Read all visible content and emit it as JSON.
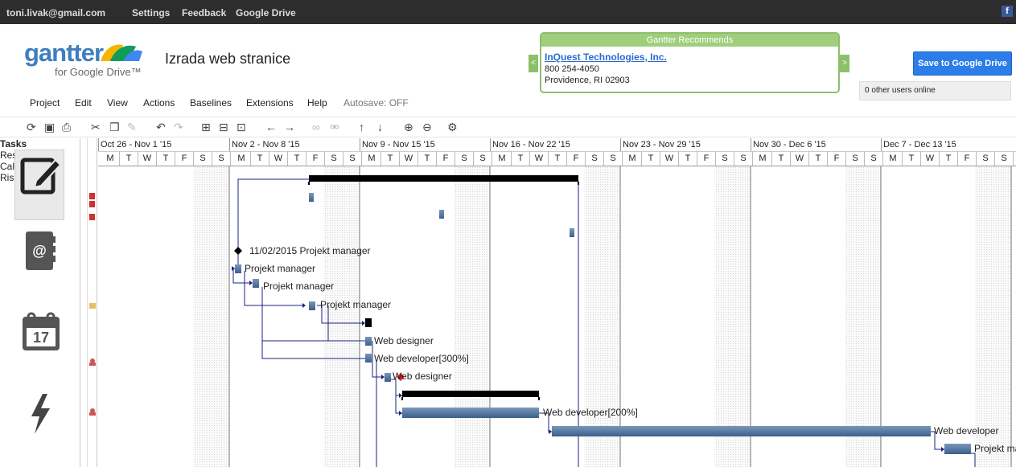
{
  "topbar": {
    "email": "toni.livak@gmail.com",
    "settings": "Settings",
    "feedback": "Feedback",
    "drive": "Google Drive",
    "facebook": "f"
  },
  "logo": {
    "brand": "gantter",
    "sub": "for Google Drive™"
  },
  "project_title": "Izrada web stranice",
  "recommend": {
    "header": "Gantter Recommends",
    "name": "InQuest Technologies, Inc.",
    "phone": "800 254-4050",
    "city": "Providence, RI 02903",
    "prev": "<",
    "next": ">"
  },
  "save_button": "Save to Google Drive",
  "users_online": "0 other users online",
  "menu": {
    "project": "Project",
    "edit": "Edit",
    "view": "View",
    "actions": "Actions",
    "baselines": "Baselines",
    "extensions": "Extensions",
    "help": "Help",
    "autosave": "Autosave: OFF"
  },
  "toolbar_icons": [
    "refresh-icon",
    "save-icon",
    "print-icon",
    "cut-icon",
    "copy-icon",
    "paste-icon",
    "undo-icon",
    "redo-icon",
    "indent-icon",
    "outdent-icon",
    "insert-icon",
    "move-left-icon",
    "move-right-icon",
    "link-icon",
    "unlink-icon",
    "move-up-icon",
    "move-down-icon",
    "zoom-in-icon",
    "zoom-out-icon",
    "settings-icon"
  ],
  "sidebar": {
    "tasks": "Tasks",
    "resources": "Resources",
    "calendars": "Calendars",
    "calendar_day": "17",
    "risks": "Risks"
  },
  "gantt": {
    "weeks": [
      "Oct 26 - Nov 1 '15",
      "Nov 2 - Nov 8 '15",
      "Nov 9 - Nov 15 '15",
      "Nov 16 - Nov 22 '15",
      "Nov 23 - Nov 29 '15",
      "Nov 30 - Dec 6 '15",
      "Dec 7 - Dec 13 '15"
    ],
    "days": [
      "M",
      "T",
      "W",
      "T",
      "F",
      "S",
      "S"
    ],
    "labels": {
      "milestone": "11/02/2015 Projekt manager",
      "pm1": "Projekt manager",
      "pm2": "Projekt manager",
      "pm3": "Projekt manager",
      "wd1": "Web designer",
      "wdev1": "Web developer[300%]",
      "wd2": "Web designer",
      "wdev2": "Web developer[200%]",
      "wdev3": "Web developer",
      "pm4": "Projekt ma"
    }
  }
}
